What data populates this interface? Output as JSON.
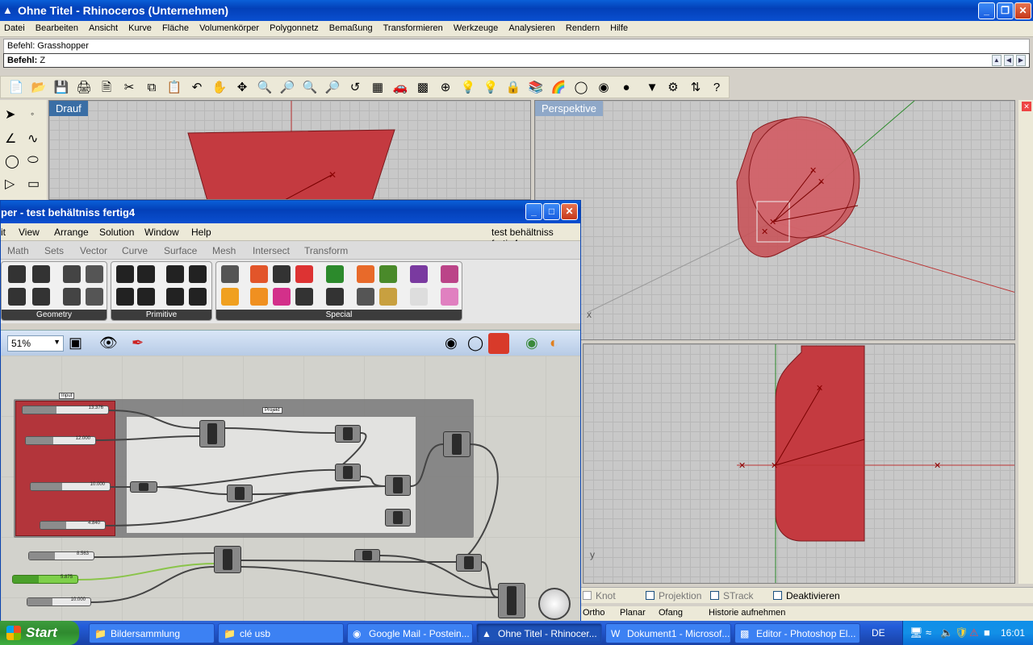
{
  "rhino": {
    "title": "Ohne Titel - Rhinoceros (Unternehmen)",
    "menu": [
      "Datei",
      "Bearbeiten",
      "Ansicht",
      "Kurve",
      "Fläche",
      "Volumenkörper",
      "Polygonnetz",
      "Bemaßung",
      "Transformieren",
      "Werkzeuge",
      "Analysieren",
      "Rendern",
      "Hilfe"
    ],
    "command_history": "Befehl: Grasshopper",
    "command_prompt": "Befehl:",
    "command_input": "Z",
    "viewports": {
      "top": "Drauf",
      "perspective": "Perspektive"
    },
    "axis_labels": {
      "x": "x",
      "y": "y"
    },
    "status": {
      "knot": "Knot",
      "projektion": "Projektion",
      "strack": "STrack",
      "deaktivieren": "Deaktivieren"
    },
    "status2": {
      "ortho": "Ortho",
      "planar": "Planar",
      "ofang": "Ofang",
      "historie": "Historie aufnehmen"
    }
  },
  "grasshopper": {
    "title": "per - test behältniss fertig4",
    "doc_name": "test behältniss fertig4",
    "menu": [
      "it",
      "View",
      "Arrange",
      "Solution",
      "Window",
      "Help"
    ],
    "tabs": [
      "Math",
      "Sets",
      "Vector",
      "Curve",
      "Surface",
      "Mesh",
      "Intersect",
      "Transform"
    ],
    "ribbon_groups": [
      "Geometry",
      "Primitive",
      "Special"
    ],
    "zoom": "51%",
    "groups": {
      "input_label": "Input",
      "project_label": "Projekt"
    },
    "sliders": [
      "13.376",
      "12.000",
      "10.000",
      "4.840",
      "8.563",
      "5.875",
      "10.000"
    ]
  },
  "taskbar": {
    "start": "Start",
    "tasks": [
      "Bildersammlung",
      "clé usb",
      "Google Mail - Postein...",
      "Ohne Titel - Rhinocer...",
      "Dokument1 - Microsof...",
      "Editor - Photoshop El..."
    ],
    "language": "DE",
    "clock": "16:01"
  },
  "colors": {
    "xp_blue": "#0a4fd0",
    "model_red": "#c43a40",
    "gh_group_red": "#b3353b"
  }
}
